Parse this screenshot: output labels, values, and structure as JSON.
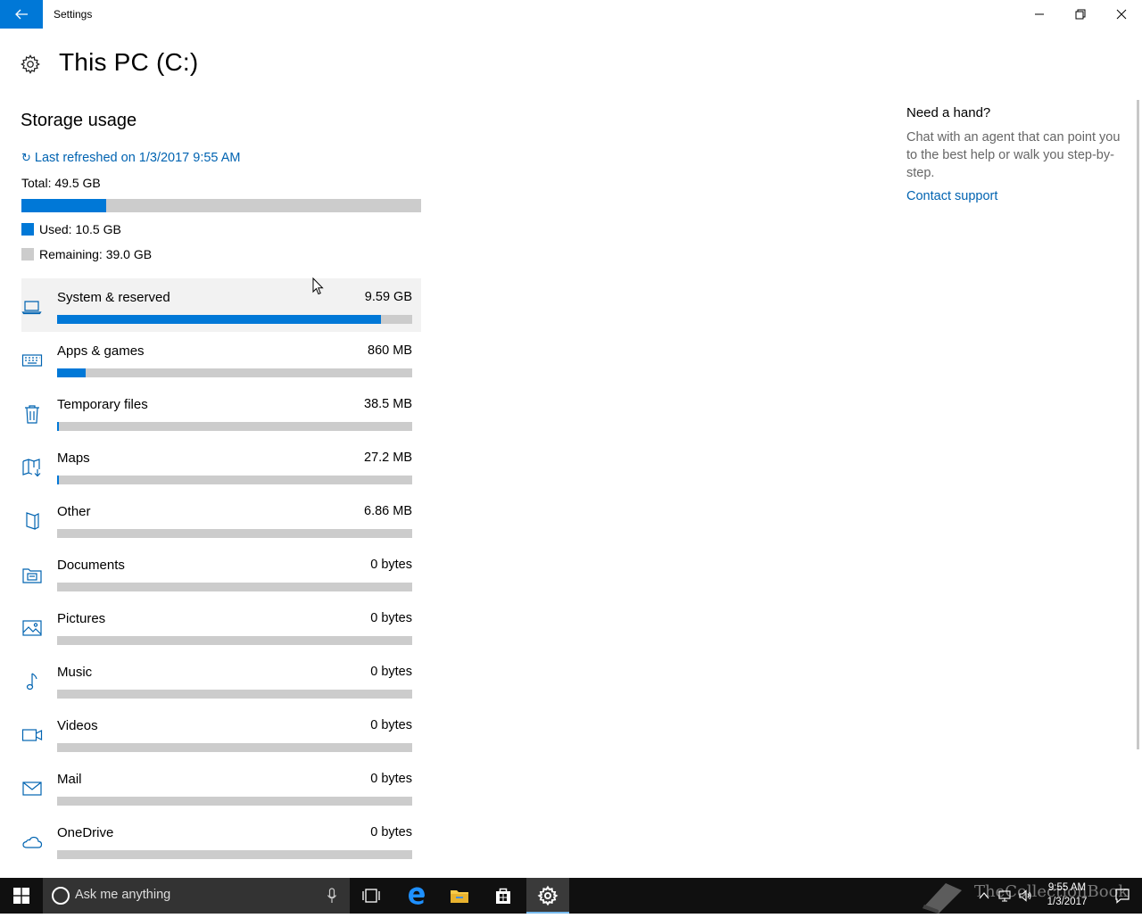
{
  "window": {
    "app_title": "Settings"
  },
  "header": {
    "page_title": "This PC (C:)"
  },
  "storage": {
    "section_title": "Storage usage",
    "refresh_icon": "↻",
    "refresh_text": "Last refreshed on 1/3/2017 9:55 AM",
    "total_text": "Total: 49.5 GB",
    "used_fraction": 0.212,
    "used_text": "Used: 10.5 GB",
    "remaining_text": "Remaining: 39.0 GB",
    "used_color": "#0078d7",
    "remaining_color": "#cccccc"
  },
  "categories": [
    {
      "name": "System & reserved",
      "size": "9.59 GB",
      "fraction": 0.913,
      "icon": "laptop-icon"
    },
    {
      "name": "Apps & games",
      "size": "860 MB",
      "fraction": 0.08,
      "icon": "keyboard-icon"
    },
    {
      "name": "Temporary files",
      "size": "38.5 MB",
      "fraction": 0.004,
      "icon": "trash-icon"
    },
    {
      "name": "Maps",
      "size": "27.2 MB",
      "fraction": 0.003,
      "icon": "map-icon"
    },
    {
      "name": "Other",
      "size": "6.86 MB",
      "fraction": 0.0,
      "icon": "other-icon"
    },
    {
      "name": "Documents",
      "size": "0 bytes",
      "fraction": 0.0,
      "icon": "documents-icon"
    },
    {
      "name": "Pictures",
      "size": "0 bytes",
      "fraction": 0.0,
      "icon": "pictures-icon"
    },
    {
      "name": "Music",
      "size": "0 bytes",
      "fraction": 0.0,
      "icon": "music-icon"
    },
    {
      "name": "Videos",
      "size": "0 bytes",
      "fraction": 0.0,
      "icon": "video-icon"
    },
    {
      "name": "Mail",
      "size": "0 bytes",
      "fraction": 0.0,
      "icon": "mail-icon"
    },
    {
      "name": "OneDrive",
      "size": "0 bytes",
      "fraction": 0.0,
      "icon": "cloud-icon"
    }
  ],
  "help": {
    "title": "Need a hand?",
    "body": "Chat with an agent that can point you to the best help or walk you step-by-step.",
    "link": "Contact support"
  },
  "taskbar": {
    "search_placeholder": "Ask me anything",
    "time": "9:55 AM",
    "date": "1/3/2017",
    "watermark_text": "TheCollectionBook"
  },
  "colors": {
    "accent": "#0078d7",
    "link": "#0063b1",
    "taskbar": "#101010"
  }
}
